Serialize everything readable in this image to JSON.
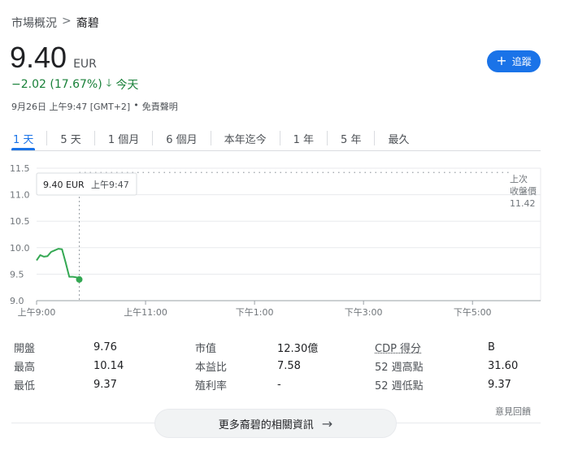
{
  "breadcrumb": {
    "parent": "市場概況",
    "separator": ">",
    "current": "裔碧"
  },
  "quote": {
    "price": "9.40",
    "currency": "EUR",
    "change": "−2.02 (17.67%)",
    "direction_icon": "arrow-down-icon",
    "period": "今天",
    "timestamp": "9月26日 上午9:47 [GMT+2]",
    "separator": "•",
    "disclaimer": "免責聲明",
    "change_color": "#188038"
  },
  "follow_button": {
    "icon": "plus-icon",
    "label": "追蹤",
    "color": "#1a73e8"
  },
  "tabs": [
    {
      "label": "1 天",
      "active": true
    },
    {
      "label": "5 天"
    },
    {
      "label": "1 個月"
    },
    {
      "label": "6 個月"
    },
    {
      "label": "本年迄今"
    },
    {
      "label": "1 年"
    },
    {
      "label": "5 年"
    },
    {
      "label": "最久"
    }
  ],
  "chart_data": {
    "type": "line",
    "y_ticks": [
      "11.5",
      "11.0",
      "10.5",
      "10.0",
      "9.5",
      "9.0"
    ],
    "ylim": [
      9.0,
      11.5
    ],
    "x_ticks": [
      "上午9:00",
      "上午11:00",
      "下午1:00",
      "下午3:00",
      "下午5:00"
    ],
    "x_tick_minutes": [
      540,
      660,
      780,
      900,
      1020
    ],
    "xlim_minutes": [
      540,
      1095
    ],
    "series": [
      {
        "x_minutes": [
          540,
          544,
          548,
          552,
          556,
          560,
          564,
          568,
          572,
          576,
          580,
          584,
          587
        ],
        "values": [
          9.76,
          9.86,
          9.83,
          9.84,
          9.92,
          9.95,
          9.98,
          9.97,
          9.72,
          9.45,
          9.45,
          9.44,
          9.4
        ],
        "color": "#34a853"
      }
    ],
    "previous_close": {
      "label_line1": "上次",
      "label_line2": "收盤價",
      "value": 11.42,
      "value_label": "11.42"
    },
    "tooltip": {
      "price": "9.40 EUR",
      "time": "上午9:47",
      "x_minutes": 587,
      "value": 9.4
    },
    "grid": true
  },
  "stats": {
    "rows": [
      [
        "開盤",
        "9.76",
        "市值",
        "12.30億",
        "CDP 得分",
        "B"
      ],
      [
        "最高",
        "10.14",
        "本益比",
        "7.58",
        "52 週高點",
        "31.60"
      ],
      [
        "最低",
        "9.37",
        "殖利率",
        "-",
        "52 週低點",
        "9.37"
      ]
    ]
  },
  "feedback": "意見回饋",
  "more_button": {
    "label": "更多裔碧的相關資訊",
    "icon": "arrow-right-icon"
  }
}
